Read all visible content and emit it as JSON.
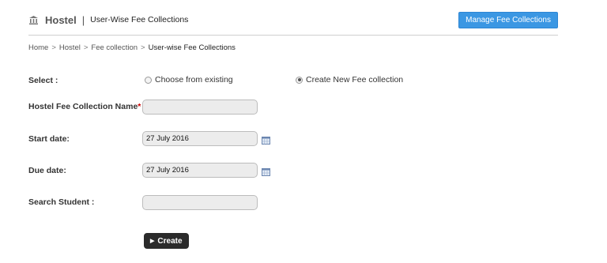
{
  "header": {
    "icon": "building-icon",
    "title": "Hostel",
    "separator": "|",
    "subtitle": "User-Wise Fee Collections",
    "manage_button": "Manage Fee Collections"
  },
  "breadcrumb": {
    "items": [
      "Home",
      "Hostel",
      "Fee collection"
    ],
    "separator": ">",
    "current": "User-wise Fee Collections"
  },
  "form": {
    "select_label": "Select :",
    "options": [
      "Choose from existing",
      "Create New Fee collection"
    ],
    "selected_option": "Create New Fee collection",
    "name_label": "Hostel Fee Collection Name",
    "required_mark": "*",
    "name_suffix": " :",
    "name_value": "",
    "start_label": "Start date:",
    "start_value": "27 July 2016",
    "due_label": "Due date:",
    "due_value": "27 July 2016",
    "search_label": "Search Student :",
    "search_value": "",
    "create_button": "Create",
    "create_icon": "play-icon"
  },
  "colors": {
    "accent": "#3b97e3",
    "required": "#cc0000",
    "button_dark": "#2b2b2b"
  }
}
